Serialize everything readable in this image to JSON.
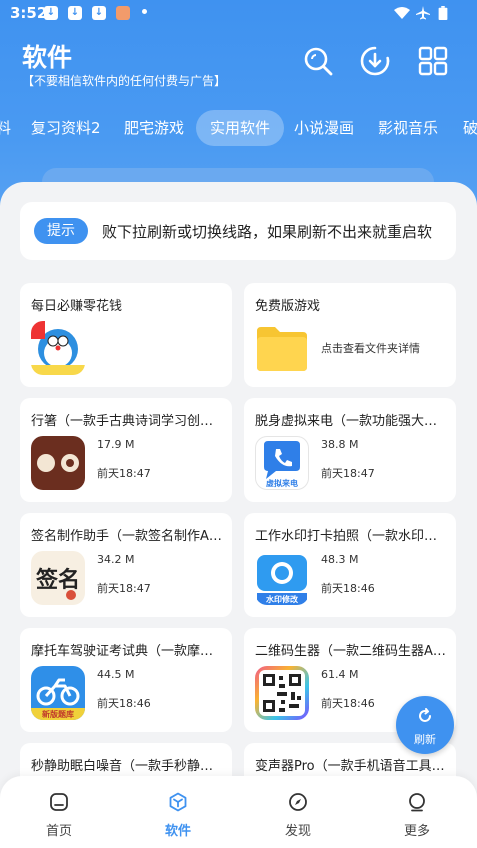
{
  "status": {
    "time": "3:52"
  },
  "header": {
    "title": "软件",
    "subtitle": "【不要相信软件内的任何付费与广告】"
  },
  "tabs": [
    {
      "label": "料"
    },
    {
      "label": "复习资料2"
    },
    {
      "label": "肥宅游戏"
    },
    {
      "label": "实用软件",
      "active": true
    },
    {
      "label": "小说漫画"
    },
    {
      "label": "影视音乐"
    },
    {
      "label": "破"
    }
  ],
  "notice": {
    "badge": "提示",
    "text": "败下拉刷新或切换线路，如果刷新不出来就重启软"
  },
  "cards": [
    {
      "title": "每日必赚零花钱",
      "icon": "doraemon-icon"
    },
    {
      "title": "免费版游戏",
      "icon": "folder-icon",
      "desc": "点击查看文件夹详情"
    },
    {
      "title": "行箸（一款手古典诗词学习创作App）",
      "icon": "xingzhu-app-icon",
      "size": "17.9 M",
      "date": "前天18:47"
    },
    {
      "title": "脱身虚拟来电（一款功能强大伪装来电App）",
      "icon": "virtual-call-icon",
      "icon_text": "虚拟来电",
      "size": "38.8 M",
      "date": "前天18:47"
    },
    {
      "title": "签名制作助手（一款签名制作App）",
      "icon": "signature-icon",
      "icon_text": "签名",
      "size": "34.2 M",
      "date": "前天18:47"
    },
    {
      "title": "工作水印打卡拍照（一款水印拍照App）",
      "icon": "camera-icon",
      "icon_text": "水印修改",
      "size": "48.3 M",
      "date": "前天18:46"
    },
    {
      "title": "摩托车驾驶证考试典（一款摩托车驾考App）",
      "icon": "motorcycle-icon",
      "icon_text": "新版题库",
      "size": "44.5 M",
      "date": "前天18:46"
    },
    {
      "title": "二维码生器（一款二维码生器App）",
      "icon": "qrcode-icon",
      "size": "61.4 M",
      "date": "前天18:46"
    },
    {
      "title": "秒静助眠白噪音（一款手秒静助眠App）",
      "icon": ""
    },
    {
      "title": "变声器Pro（一款手机语音工具App）",
      "icon": ""
    }
  ],
  "fab": {
    "label": "刷新"
  },
  "bottom_nav": [
    {
      "label": "首页"
    },
    {
      "label": "软件",
      "active": true
    },
    {
      "label": "发现"
    },
    {
      "label": "更多"
    }
  ],
  "colors": {
    "accent": "#3f92f0"
  }
}
